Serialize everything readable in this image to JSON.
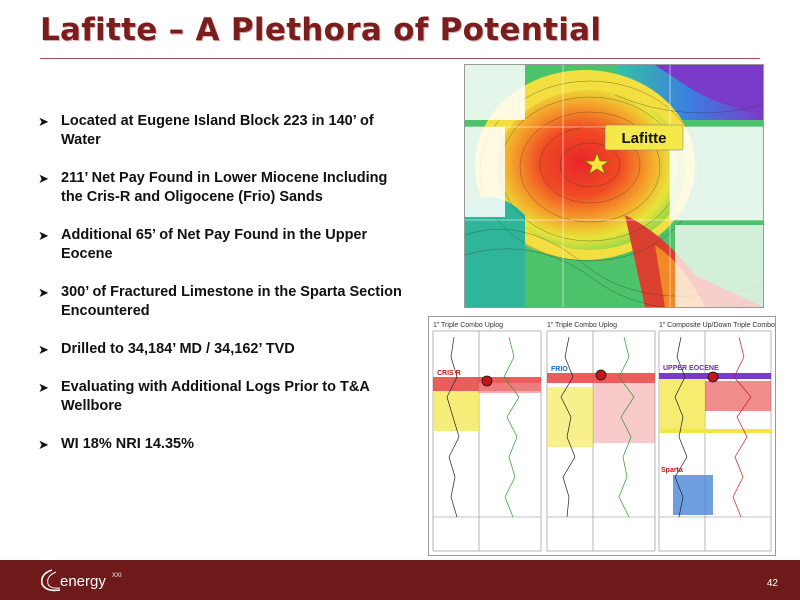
{
  "slide": {
    "title": "Lafitte – A Plethora of Potential",
    "page_number": "42"
  },
  "bullets": [
    {
      "text": "Located at Eugene Island Block 223 in 140’ of Water"
    },
    {
      "text": "211’ Net Pay Found in Lower Miocene Including the Cris-R and Oligocene (Frio) Sands"
    },
    {
      "text": "Additional 65’ of Net Pay Found in the Upper Eocene"
    },
    {
      "text": "300’ of Fractured Limestone in the Sparta Section Encountered"
    },
    {
      "text": "Drilled to 34,184’ MD / 34,162’ TVD"
    },
    {
      "text": "Evaluating with Additional Logs Prior to T&A Wellbore"
    },
    {
      "text": "WI 18% NRI 14.35%"
    }
  ],
  "map": {
    "callout_label": "Lafitte",
    "icon": "star-icon"
  },
  "logs": {
    "panels": [
      {
        "header": "1” Triple Combo Uplog",
        "zone": "CRIS R"
      },
      {
        "header": "1” Triple Combo Uplog",
        "zone": "FRIO"
      },
      {
        "header": "1” Composite Up/Down Triple Combo",
        "zone": "UPPER EOCENE",
        "zone2": "Sparta"
      }
    ]
  },
  "brand": {
    "logo_text": "energy",
    "logo_super": "XXI",
    "accent": "#7b1d1d",
    "footer_color": "#6e1a1a"
  }
}
